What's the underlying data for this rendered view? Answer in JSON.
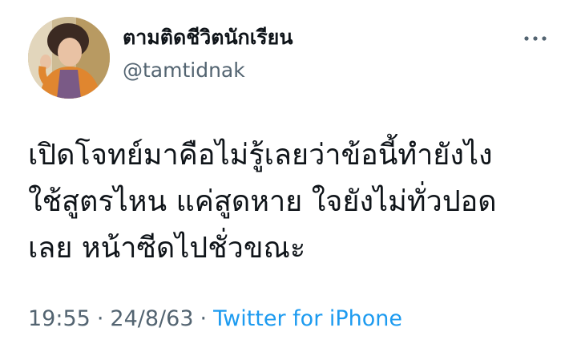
{
  "author": {
    "display_name": "ตามติดชีวิตนักเรียน",
    "handle": "@tamtidnak"
  },
  "more_menu": {
    "icon": "more-horizontal-icon"
  },
  "tweet": {
    "text": "เปิดโจทย์มาคือไม่รู้เลยว่าข้อนี้ทำยังไง\nใช้สูตรไหน แค่สูดหาย ใจยังไม่ทั่วปอด\nเลย หน้าซีดไปชั่วขณะ",
    "time": "19:55",
    "date": "24/8/63",
    "separator": "·",
    "source": "Twitter for iPhone"
  },
  "colors": {
    "text": "#0f1419",
    "secondary": "#536471",
    "link": "#1d9bf0"
  }
}
